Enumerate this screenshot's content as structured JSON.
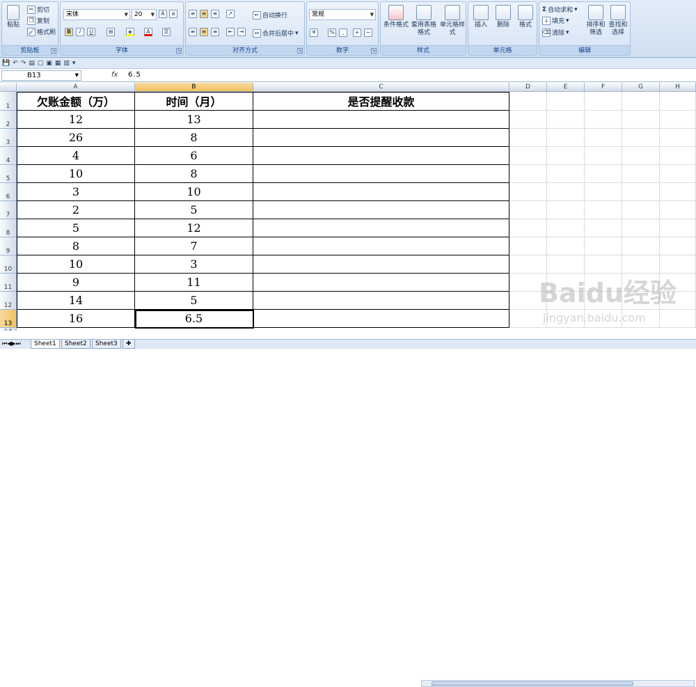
{
  "ribbon": {
    "clipboard": {
      "title": "剪贴板",
      "paste": "粘贴",
      "cut": "剪切",
      "copy": "复制",
      "format_painter": "格式刷"
    },
    "font": {
      "title": "字体",
      "font_name": "宋体",
      "font_size": "20",
      "bold": "B",
      "italic": "I",
      "underline": "U"
    },
    "alignment": {
      "title": "对齐方式",
      "wrap_text": "自动换行",
      "merge_center": "合并后居中"
    },
    "number": {
      "title": "数字",
      "format": "常规",
      "percent": "%",
      "comma": ","
    },
    "styles": {
      "title": "样式",
      "conditional": "条件格式",
      "table_format": "套用表格格式",
      "cell_styles": "单元格样式"
    },
    "cells": {
      "title": "单元格",
      "insert": "插入",
      "delete": "删除",
      "format": "格式"
    },
    "editing": {
      "title": "编辑",
      "autosum": "自动求和",
      "fill": "填充",
      "clear": "清除",
      "sort_filter": "排序和筛选",
      "find_select": "查找和选择"
    }
  },
  "formula_bar": {
    "name_box": "B13",
    "fx": "fx",
    "value": "6.5"
  },
  "columns": [
    "A",
    "B",
    "C",
    "D",
    "E",
    "F",
    "G",
    "H"
  ],
  "rows": [
    "1",
    "2",
    "3",
    "4",
    "5",
    "6",
    "7",
    "8",
    "9",
    "10",
    "11",
    "12",
    "13"
  ],
  "table": {
    "headers": [
      "欠账金额（万）",
      "时间（月）",
      "是否提醒收款"
    ],
    "data": [
      [
        "12",
        "13",
        ""
      ],
      [
        "26",
        "8",
        ""
      ],
      [
        "4",
        "6",
        ""
      ],
      [
        "10",
        "8",
        ""
      ],
      [
        "3",
        "10",
        ""
      ],
      [
        "2",
        "5",
        ""
      ],
      [
        "5",
        "12",
        ""
      ],
      [
        "8",
        "7",
        ""
      ],
      [
        "10",
        "3",
        ""
      ],
      [
        "9",
        "11",
        ""
      ],
      [
        "14",
        "5",
        ""
      ],
      [
        "16",
        "6.5",
        ""
      ]
    ]
  },
  "sheets": [
    "Sheet1",
    "Sheet2",
    "Sheet3"
  ],
  "watermark": {
    "brand": "Baidu经验",
    "url": "jingyan.baidu.com"
  }
}
